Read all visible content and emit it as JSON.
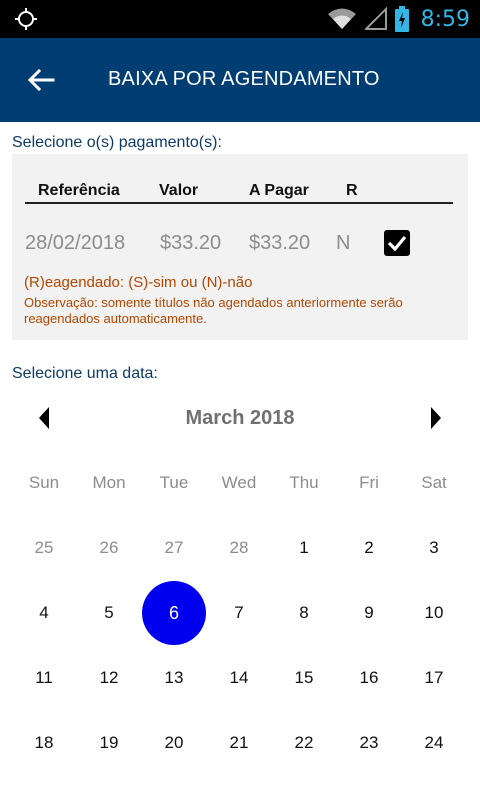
{
  "status_bar": {
    "time": "8:59"
  },
  "app_bar": {
    "title": "BAIXA POR AGENDAMENTO"
  },
  "payments": {
    "label": "Selecione o(s) pagamento(s):",
    "headers": [
      "Referência",
      "Valor",
      "A Pagar",
      "R"
    ],
    "rows": [
      {
        "referencia": "28/02/2018",
        "valor": "$33.20",
        "a_pagar": "$33.20",
        "r": "N",
        "checked": true
      }
    ],
    "legend": "(R)eagendado: (S)-sim ou (N)-não",
    "observation": "Observação: somente títulos não agendados anteriormente serão reagendados automaticamente."
  },
  "calendar": {
    "label": "Selecione uma data:",
    "month_title": "March 2018",
    "weekdays": [
      "Sun",
      "Mon",
      "Tue",
      "Wed",
      "Thu",
      "Fri",
      "Sat"
    ],
    "weeks": [
      [
        "25",
        "26",
        "27",
        "28",
        "1",
        "2",
        "3"
      ],
      [
        "4",
        "5",
        "6",
        "7",
        "8",
        "9",
        "10"
      ],
      [
        "11",
        "12",
        "13",
        "14",
        "15",
        "16",
        "17"
      ],
      [
        "18",
        "19",
        "20",
        "21",
        "22",
        "23",
        "24"
      ]
    ],
    "selected_day": "6",
    "colors": {
      "selected": "#0000ee",
      "app_bar": "#003d73",
      "note": "#b34700"
    }
  }
}
